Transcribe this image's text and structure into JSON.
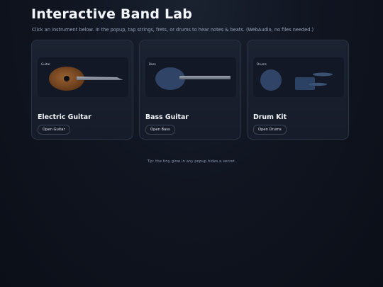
{
  "header": {
    "title": "Interactive Band Lab",
    "subtitle": "Click an instrument below. In the popup, tap strings, frets, or drums to hear notes & beats. (WebAudio, no files needed.)"
  },
  "cards": [
    {
      "stage_label": "Guitar",
      "title": "Electric Guitar",
      "button_label": "Open Guitar",
      "icon": "guitar-icon"
    },
    {
      "stage_label": "Bass",
      "title": "Bass Guitar",
      "button_label": "Open Bass",
      "icon": "bass-icon"
    },
    {
      "stage_label": "Drums",
      "title": "Drum Kit",
      "button_label": "Open Drums",
      "icon": "drum-kit-icon"
    }
  ],
  "footer": {
    "tip": "Tip: the tiny glow in any popup hides a secret."
  },
  "colors": {
    "background": "#0b0f17",
    "card": "#1b2231",
    "guitar_body": "#7a4a22",
    "bass_body": "#2f4466",
    "drums": "#2f4466"
  }
}
